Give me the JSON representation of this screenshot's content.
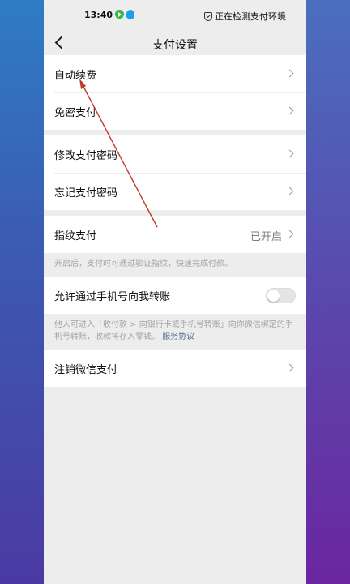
{
  "status_bar": {
    "time": "13:40",
    "detect_text": "正在检测支付环境",
    "icons": [
      "play-app-icon",
      "qq-icon",
      "shield-icon"
    ]
  },
  "nav": {
    "title": "支付设置",
    "back_icon": "back-arrow-icon"
  },
  "group1": {
    "auto_renew": "自动续费",
    "password_free": "免密支付"
  },
  "group2": {
    "change_password": "修改支付密码",
    "forgot_password": "忘记支付密码"
  },
  "fingerprint": {
    "label": "指纹支付",
    "value": "已开启",
    "note": "开启后，支付时可通过验证指纹，快速完成付款。"
  },
  "phone_transfer": {
    "label": "允许通过手机号向我转账",
    "enabled": false,
    "note": "他人可进入「收付款 > 向银行卡或手机号转账」向你微信绑定的手机号转账，收款将存入零钱。",
    "link": "服务协议"
  },
  "cancel": {
    "label": "注销微信支付"
  },
  "colors": {
    "annotation_arrow": "#c0392b",
    "link": "#566b94",
    "toggle_off": "#e5e5e5"
  }
}
